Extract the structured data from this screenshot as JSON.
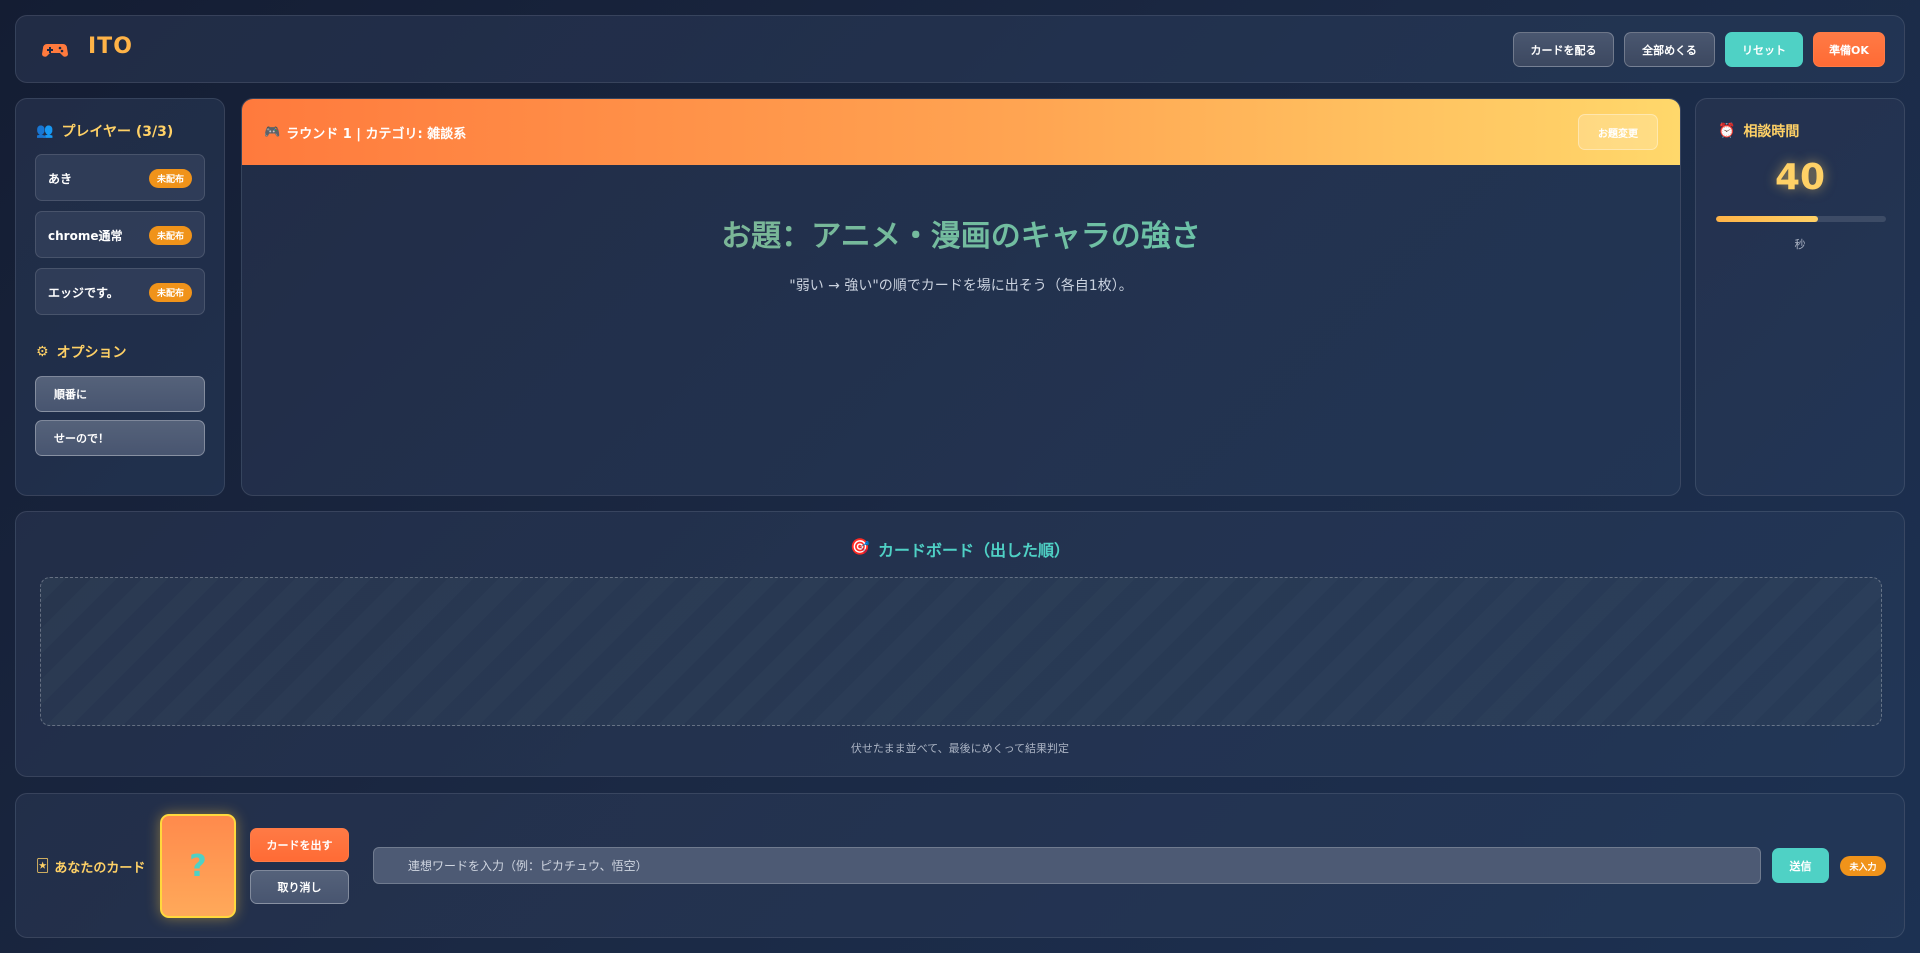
{
  "app": {
    "title": "ITO"
  },
  "header": {
    "buttons": {
      "deal": "カードを配る",
      "reveal_all": "全部めくる",
      "reset": "リセット",
      "ready": "準備OK"
    }
  },
  "players": {
    "title": "プレイヤー (3/3)",
    "items": [
      {
        "name": "あき",
        "status": "未配布"
      },
      {
        "name": "chrome通常",
        "status": "未配布"
      },
      {
        "name": "エッジです。",
        "status": "未配布"
      }
    ]
  },
  "options": {
    "title": "オプション",
    "items": [
      "順番に",
      "せーので！"
    ]
  },
  "topic": {
    "round_label": "ラウンド 1 | カテゴリ: 雑談系",
    "change_button": "お題変更",
    "title": "お題：アニメ・漫画のキャラの強さ",
    "subtitle": "\"弱い → 強い\"の順でカードを場に出そう（各自1枚）。"
  },
  "timer": {
    "title": "相談時間",
    "value": "40",
    "unit": "秒",
    "progress": 0.6
  },
  "board": {
    "title": "カードボード（出した順）",
    "note": "伏せたまま並べて、最後にめくって結果判定"
  },
  "hand": {
    "label": "あなたのカード",
    "card_value": "?",
    "play_button": "カードを出す",
    "undo_button": "取り消し",
    "input_placeholder": "連想ワードを入力（例：ピカチュウ、悟空）",
    "send_button": "送信",
    "status_badge": "未入力"
  },
  "colors": {
    "accent_orange": "#ff6b35",
    "accent_teal": "#4fd1c5",
    "accent_yellow": "#ffd166",
    "badge_orange": "#f0931a"
  }
}
